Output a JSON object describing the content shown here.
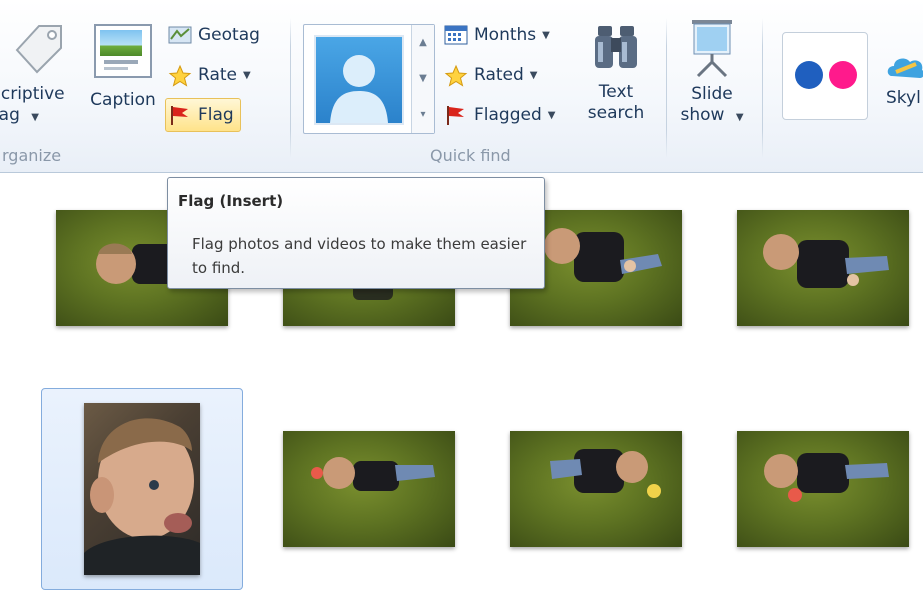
{
  "ribbon": {
    "organize": {
      "label": "rganize",
      "descriptive_tag_line1": "scriptive",
      "descriptive_tag_line2": "tag",
      "caption": "Caption",
      "geotag": "Geotag",
      "rate": "Rate",
      "flag": "Flag"
    },
    "quick_find": {
      "label": "Quick find",
      "months": "Months",
      "rated": "Rated",
      "flagged": "Flagged",
      "text_search_line1": "Text",
      "text_search_line2": "search"
    },
    "slide_show_line1": "Slide",
    "slide_show_line2": "show",
    "share": {
      "skydrive_partial": "Skyl"
    }
  },
  "tooltip": {
    "title": "Flag (Insert)",
    "body": "Flag photos and videos to make them easier to find."
  },
  "colors": {
    "flickr_blue": "#1f5fbf",
    "flickr_pink": "#ff1a8c",
    "selection_border": "#84acdd",
    "flag_hot": "#ffe38a"
  }
}
